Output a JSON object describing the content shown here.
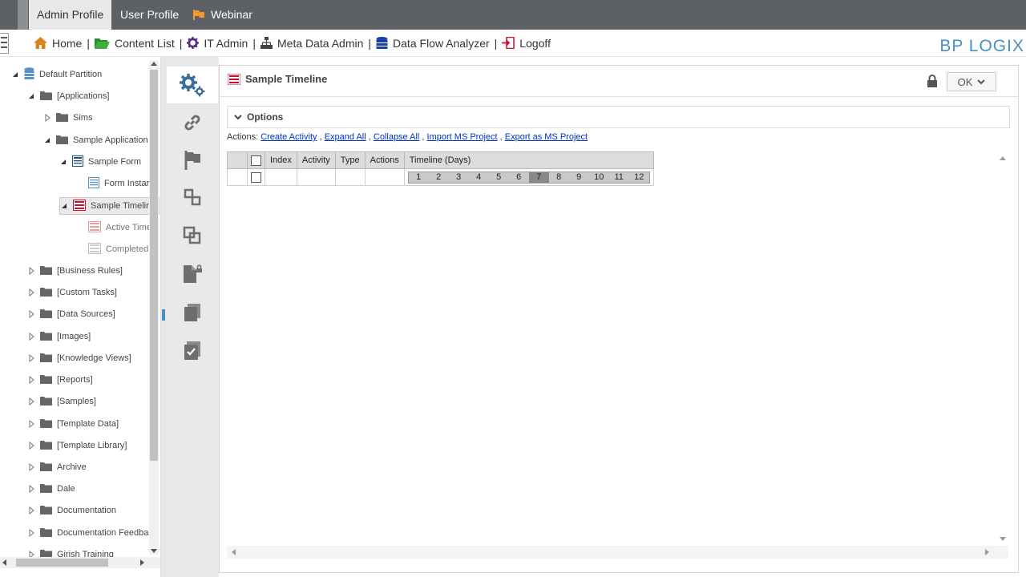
{
  "tabs": [
    {
      "label": "Admin Profile",
      "active": true
    },
    {
      "label": "User Profile",
      "active": false
    },
    {
      "label": "Webinar",
      "active": false
    }
  ],
  "nav": {
    "items": [
      {
        "label": "Home",
        "icon": "home-icon"
      },
      {
        "label": "Content List",
        "icon": "folder-open-icon"
      },
      {
        "label": "IT Admin",
        "icon": "gear-icon"
      },
      {
        "label": "Meta Data Admin",
        "icon": "hierarchy-icon"
      },
      {
        "label": "Data Flow Analyzer",
        "icon": "database-icon"
      },
      {
        "label": "Logoff",
        "icon": "logoff-icon"
      }
    ],
    "separator": "|",
    "logo_a": "BP",
    "logo_b": "LOGIX"
  },
  "tree": {
    "items": [
      {
        "label": "Default Partition",
        "depth": 0,
        "icon": "database-icon",
        "expanded": true
      },
      {
        "label": "[Applications]",
        "depth": 1,
        "icon": "folder-icon",
        "expanded": true
      },
      {
        "label": "Sims",
        "depth": 2,
        "icon": "folder-icon",
        "expanded": false
      },
      {
        "label": "Sample Application",
        "depth": 2,
        "icon": "folder-icon",
        "expanded": true
      },
      {
        "label": "Sample Form",
        "depth": 3,
        "icon": "form-icon",
        "expanded": true
      },
      {
        "label": "Form Instar",
        "depth": 4,
        "icon": "form-instance-icon",
        "leaf": true
      },
      {
        "label": "Sample Timeline",
        "depth": 3,
        "icon": "timeline-icon",
        "expanded": true,
        "selected": true
      },
      {
        "label": "Active Time",
        "depth": 4,
        "icon": "timeline-active-icon",
        "leaf": true
      },
      {
        "label": "Completed",
        "depth": 4,
        "icon": "timeline-completed-icon",
        "leaf": true
      },
      {
        "label": "[Business Rules]",
        "depth": 1,
        "icon": "folder-icon",
        "expanded": false
      },
      {
        "label": "[Custom Tasks]",
        "depth": 1,
        "icon": "folder-icon",
        "expanded": false
      },
      {
        "label": "[Data Sources]",
        "depth": 1,
        "icon": "folder-icon",
        "expanded": false
      },
      {
        "label": "[Images]",
        "depth": 1,
        "icon": "folder-icon",
        "expanded": false
      },
      {
        "label": "[Knowledge Views]",
        "depth": 1,
        "icon": "folder-icon",
        "expanded": false
      },
      {
        "label": "[Reports]",
        "depth": 1,
        "icon": "folder-icon",
        "expanded": false
      },
      {
        "label": "[Samples]",
        "depth": 1,
        "icon": "folder-icon",
        "expanded": false
      },
      {
        "label": "[Template Data]",
        "depth": 1,
        "icon": "folder-icon",
        "expanded": false
      },
      {
        "label": "[Template Library]",
        "depth": 1,
        "icon": "folder-icon",
        "expanded": false
      },
      {
        "label": "Archive",
        "depth": 1,
        "icon": "folder-icon",
        "expanded": false
      },
      {
        "label": "Dale",
        "depth": 1,
        "icon": "folder-icon",
        "expanded": false
      },
      {
        "label": "Documentation",
        "depth": 1,
        "icon": "folder-icon",
        "expanded": false
      },
      {
        "label": "Documentation Feedbac",
        "depth": 1,
        "icon": "folder-icon",
        "expanded": false
      },
      {
        "label": "Girish Training",
        "depth": 1,
        "icon": "folder-icon",
        "expanded": false
      }
    ]
  },
  "sidebar_icons": [
    "settings-gears-icon",
    "link-icon",
    "flag-icon",
    "move-icon",
    "copy-icon",
    "document-lock-icon",
    "duplicate-icon",
    "checklist-icon"
  ],
  "panel": {
    "title": "Sample Timeline",
    "ok_label": "OK",
    "options_label": "Options",
    "actions_prefix": "Actions:",
    "actions": [
      "Create Activity",
      "Expand All",
      "Collapse All",
      "Import MS Project",
      "Export as MS Project"
    ],
    "actions_separator": ",",
    "columns": [
      "Index",
      "Activity",
      "Type",
      "Actions",
      "Timeline (Days)"
    ],
    "days": [
      "1",
      "2",
      "3",
      "4",
      "5",
      "6",
      "7",
      "8",
      "9",
      "10",
      "11",
      "12"
    ],
    "today_day": "7"
  }
}
